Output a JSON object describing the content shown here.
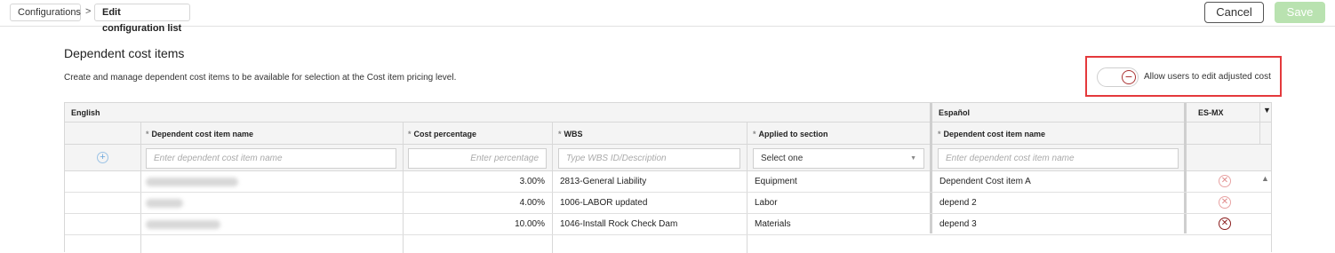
{
  "breadcrumb": {
    "items": [
      "Configurations",
      "Edit configuration list"
    ],
    "separator": ">"
  },
  "actions": {
    "cancel_label": "Cancel",
    "save_label": "Save"
  },
  "section": {
    "title": "Dependent cost items",
    "description": "Create and manage dependent cost items to be available for selection at the Cost item pricing level."
  },
  "toggle": {
    "label": "Allow users to edit adjusted cost",
    "on": false
  },
  "grid": {
    "groups": {
      "english": "English",
      "espanol": "Español",
      "esmx": "ES-MX"
    },
    "columns": {
      "name": "Dependent cost item name",
      "cost": "Cost percentage",
      "wbs": "WBS",
      "section": "Applied to section",
      "es_name": "Dependent cost item name",
      "required_marker": "*"
    },
    "filters": {
      "name_placeholder": "Enter dependent cost item name",
      "cost_placeholder": "Enter percentage",
      "wbs_placeholder": "Type WBS ID/Description",
      "section_value": "Select one",
      "es_name_placeholder": "Enter dependent cost item name"
    },
    "rows": [
      {
        "cost": "3.00%",
        "wbs": "2813-General Liability",
        "section": "Equipment",
        "es_name": "Dependent Cost item A"
      },
      {
        "cost": "4.00%",
        "wbs": "1006-LABOR updated",
        "section": "Labor",
        "es_name": "depend 2"
      },
      {
        "cost": "10.00%",
        "wbs": "1046-Install Rock Check Dam",
        "section": "Materials",
        "es_name": "depend 3"
      }
    ]
  },
  "colors": {
    "accent_red": "#e4393c",
    "save_disabled": "#b9e2b0",
    "delete_icon": "#e08a8a"
  },
  "icons": [
    "chevron-right-icon",
    "minus-circle-icon",
    "add-circle-icon",
    "delete-circle-icon",
    "caret-down-icon",
    "scroll-up-icon"
  ]
}
